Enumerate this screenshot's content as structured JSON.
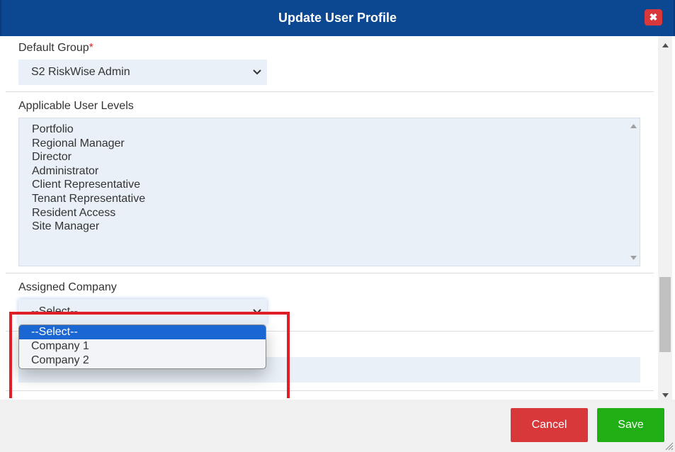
{
  "dialog": {
    "title": "Update User Profile",
    "close_glyph": "✖"
  },
  "default_group": {
    "label": "Default Group",
    "required_mark": "*",
    "value": "S2 RiskWise Admin"
  },
  "user_levels": {
    "label": "Applicable User Levels",
    "items": [
      "Portfolio",
      "Regional Manager",
      "Director",
      "Administrator",
      "Client Representative",
      "Tenant Representative",
      "Resident Access",
      "Site Manager"
    ]
  },
  "assigned_company": {
    "label": "Assigned Company",
    "value": "--Select--",
    "options": [
      "--Select--",
      "Company 1",
      "Company 2"
    ],
    "selected_index": 0
  },
  "footer": {
    "cancel_label": "Cancel",
    "save_label": "Save"
  },
  "colors": {
    "titlebar": "#0b4891",
    "cancel": "#d9383b",
    "save": "#1fae14",
    "highlight": "#e01e27",
    "field_bg": "#e9f0f8",
    "selected_option": "#1a66d2"
  },
  "icons": {
    "close": "close-icon",
    "dropdown": "chevron-down-icon",
    "scroll_up": "scroll-up-arrow-icon",
    "scroll_down": "scroll-down-arrow-icon",
    "resize": "resize-grip-icon"
  }
}
